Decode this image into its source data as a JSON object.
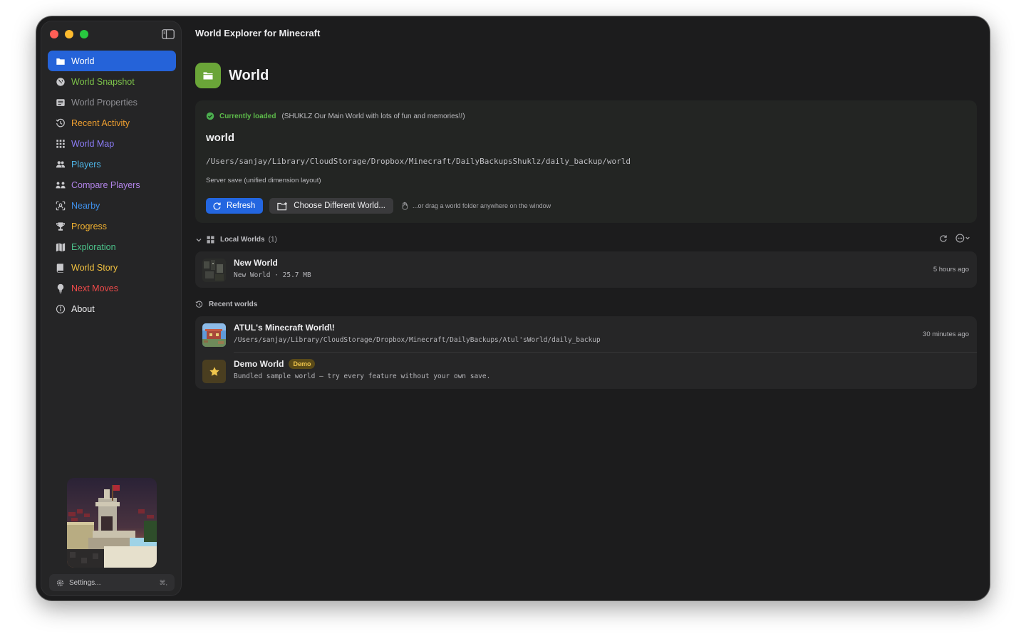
{
  "app": {
    "title": "World Explorer for Minecraft"
  },
  "sidebar": {
    "items": [
      {
        "label": "World",
        "icon": "folder-icon",
        "color": "#ffffff",
        "active": true
      },
      {
        "label": "World Snapshot",
        "icon": "globe-icon",
        "color": "#7cc24a"
      },
      {
        "label": "World Properties",
        "icon": "list-icon",
        "color": "#8e8e93"
      },
      {
        "label": "Recent Activity",
        "icon": "clock-history-icon",
        "color": "#f0a030"
      },
      {
        "label": "World Map",
        "icon": "grid-icon",
        "color": "#8b7cf6"
      },
      {
        "label": "Players",
        "icon": "people-icon",
        "color": "#4fb6e8"
      },
      {
        "label": "Compare Players",
        "icon": "compare-people-icon",
        "color": "#b284e8"
      },
      {
        "label": "Nearby",
        "icon": "nearby-icon",
        "color": "#3f8fe8"
      },
      {
        "label": "Progress",
        "icon": "trophy-icon",
        "color": "#f0b030"
      },
      {
        "label": "Exploration",
        "icon": "map-icon",
        "color": "#4cc28a"
      },
      {
        "label": "World Story",
        "icon": "book-icon",
        "color": "#f0c040"
      },
      {
        "label": "Next Moves",
        "icon": "lightbulb-icon",
        "color": "#f04a4a"
      },
      {
        "label": "About",
        "icon": "info-icon",
        "color": "#ececee"
      }
    ],
    "settings": {
      "label": "Settings...",
      "shortcut": "⌘,"
    }
  },
  "header": {
    "title": "World"
  },
  "current": {
    "status_label": "Currently loaded",
    "description": "(SHUKLZ Our Main World with lots of fun and memories\\!)",
    "name": "world",
    "path": "/Users/sanjay/Library/CloudStorage/Dropbox/Minecraft/DailyBackupsShuklz/daily_backup/world",
    "type": "Server save (unified dimension layout)",
    "refresh_label": "Refresh",
    "choose_label": "Choose Different World...",
    "drag_hint": "...or drag a world folder anywhere on the window"
  },
  "local_worlds": {
    "title": "Local Worlds",
    "count": "(1)",
    "items": [
      {
        "name": "New World",
        "detail": "New World · 25.7 MB",
        "time": "5 hours ago"
      }
    ]
  },
  "recent_worlds": {
    "title": "Recent worlds",
    "items": [
      {
        "name": "ATUL's Minecraft World\\!",
        "detail": "/Users/sanjay/Library/CloudStorage/Dropbox/Minecraft/DailyBackups/Atul'sWorld/daily_backup",
        "time": "30 minutes ago"
      },
      {
        "name": "Demo World",
        "badge": "Demo",
        "detail": "Bundled sample world — try every feature without your own save.",
        "time": ""
      }
    ]
  }
}
